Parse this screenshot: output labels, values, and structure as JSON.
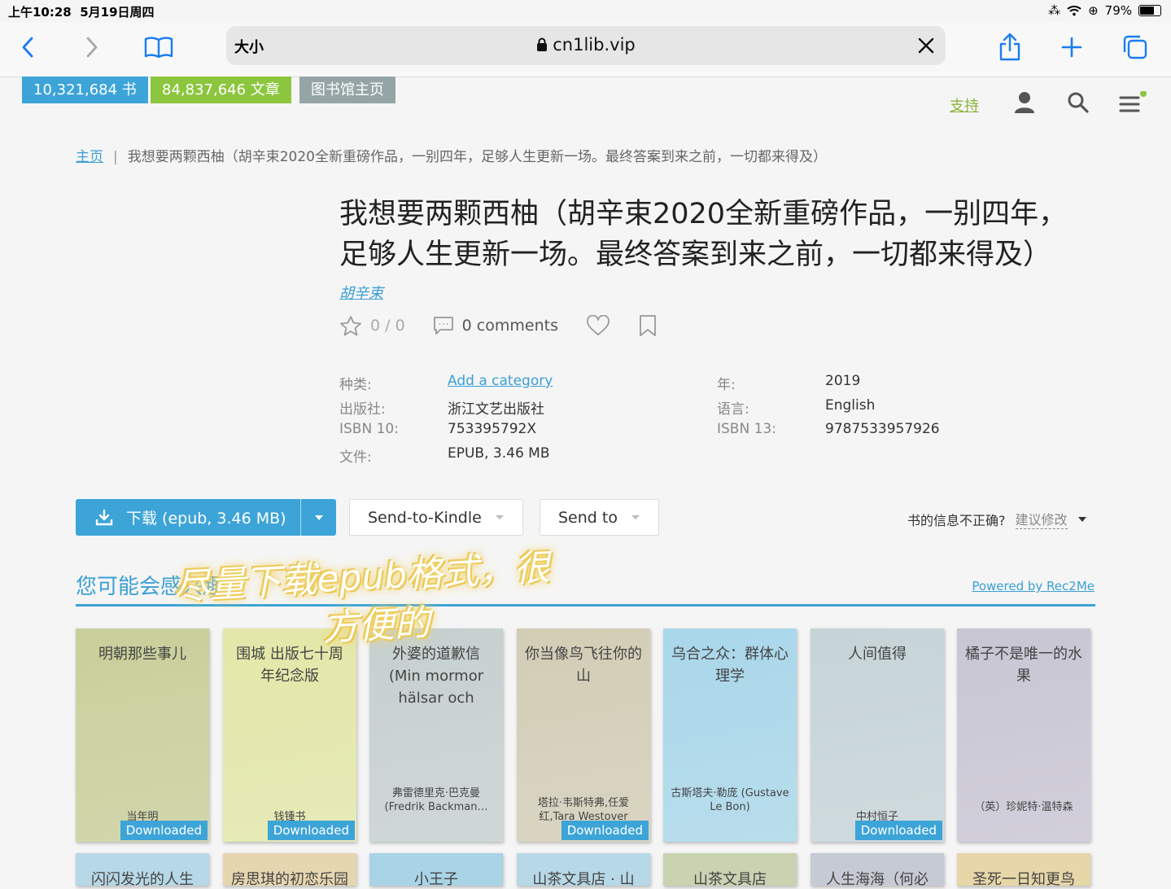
{
  "status": {
    "time": "上午10:28",
    "date": "5月19日周四",
    "battery": "79%",
    "battery_fraction": 0.79
  },
  "browser": {
    "reader_label": "大小",
    "url": "cn1lib.vip"
  },
  "header": {
    "books_count": "10,321,684 书",
    "articles_count": "84,837,646 文章",
    "library_home": "图书馆主页",
    "support": "支持"
  },
  "breadcrumb": {
    "home": "主页",
    "current": "我想要两颗西柚（胡辛束2020全新重磅作品，一别四年，足够人生更新一场。最终答案到来之前，一切都来得及）"
  },
  "book": {
    "title_line1": "我想要两颗西柚（胡辛束2020全新重磅作品，一别四年，",
    "title_line2": "足够人生更新一场。最终答案到来之前，一切都来得及）",
    "author": "胡辛束",
    "rating": "0 / 0",
    "comments": "0 comments",
    "details_left": [
      {
        "label": "种类:",
        "value": "Add a category"
      },
      {
        "label": "出版社:",
        "value": "浙江文艺出版社"
      },
      {
        "label": "ISBN 10:",
        "value": "753395792X"
      },
      {
        "label": "文件:",
        "value": "EPUB, 3.46 MB"
      }
    ],
    "details_right": [
      {
        "label": "年:",
        "value": "2019"
      },
      {
        "label": "语言:",
        "value": "English"
      },
      {
        "label": "ISBN 13:",
        "value": "9787533957926"
      }
    ]
  },
  "actions": {
    "download": "下载 (epub, 3.46 MB)",
    "send_kindle": "Send-to-Kindle",
    "send_to": "Send to",
    "wrong_info": "书的信息不正确?",
    "suggest": "建议修改"
  },
  "recommend": {
    "title": "您可能会感兴趣",
    "powered": "Powered by Rec2Me",
    "overlay_line1": "尽量下载epub格式，很",
    "overlay_line2": "方便的",
    "books": [
      {
        "title": "明朝那些事儿",
        "author": "当年明",
        "downloaded": "Downloaded",
        "color": "#c9cf9a"
      },
      {
        "title": "围城 出版七十周年纪念版",
        "author": "钱锺书",
        "downloaded": "Downloaded",
        "color": "#e3e7a8"
      },
      {
        "title": "外婆的道歉信 (Min mormor hälsar och",
        "author": "弗雷德里克·巴克曼 (Fredrik Backman…",
        "downloaded": "",
        "color": "#c6d0cf"
      },
      {
        "title": "你当像鸟飞往你的山",
        "author": "塔拉·韦斯特弗,任爱红,Tara Westover",
        "downloaded": "Downloaded",
        "color": "#d3cdb6"
      },
      {
        "title": "乌合之众：群体心理学",
        "author": "古斯塔夫·勒庞 (Gustave Le Bon)",
        "downloaded": "",
        "color": "#a9d7ea"
      },
      {
        "title": "人间值得",
        "author": "中村恒子",
        "downloaded": "Downloaded",
        "color": "#c6d4d8"
      },
      {
        "title": "橘子不是唯一的水果",
        "author": "（英）珍妮特·温特森",
        "downloaded": "",
        "color": "#c9c6d4"
      }
    ],
    "books_row2": [
      {
        "title": "闪闪发光的人生",
        "color": "#b7d8e6"
      },
      {
        "title": "房思琪的初恋乐园",
        "color": "#e6d6b0"
      },
      {
        "title": "小王子",
        "color": "#a9d4e6"
      },
      {
        "title": "山茶文具店 · 山",
        "color": "#b7d8e6"
      },
      {
        "title": "山茶文具店",
        "color": "#c9d3b2"
      },
      {
        "title": "人生海海（何必",
        "color": "#c6cad4"
      },
      {
        "title": "圣死一日知更鸟",
        "color": "#e6d6a8"
      }
    ]
  }
}
